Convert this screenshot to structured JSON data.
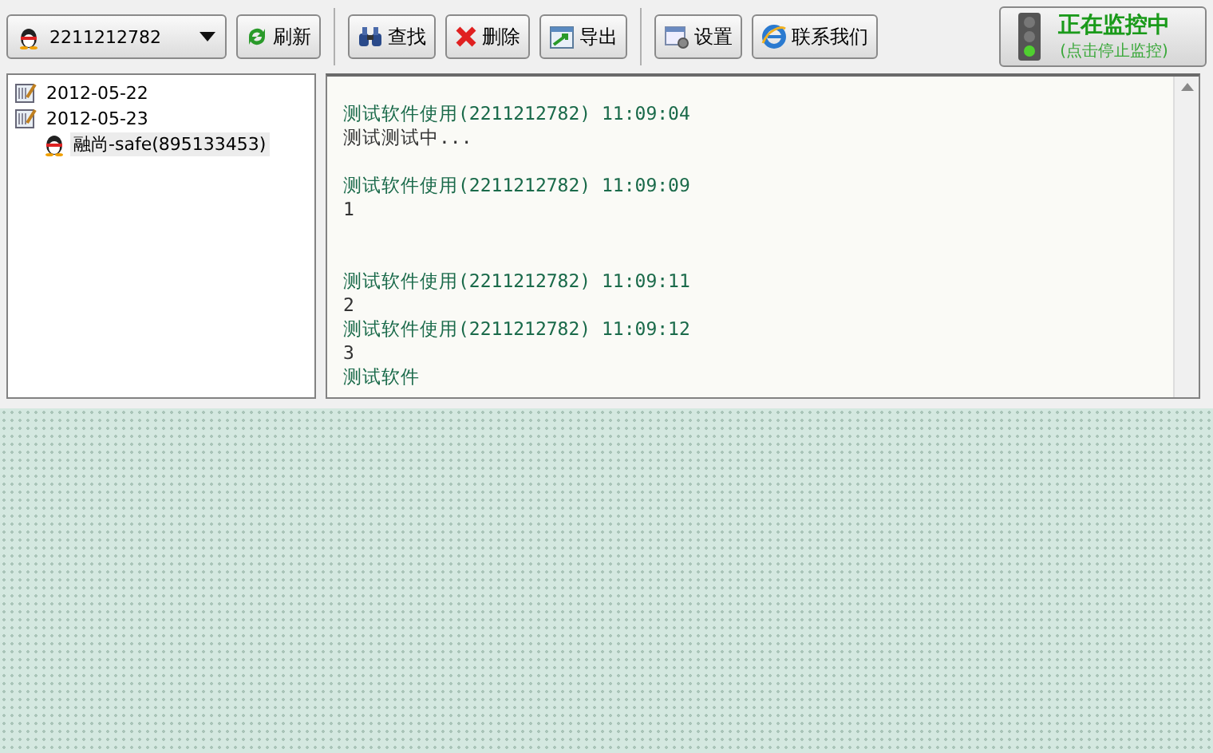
{
  "toolbar": {
    "account": {
      "value": "2211212782"
    },
    "buttons": [
      {
        "kind": "refresh",
        "label": "刷新"
      },
      {
        "kind": "find",
        "label": "查找"
      },
      {
        "kind": "delete",
        "label": "删除"
      },
      {
        "kind": "export",
        "label": "导出"
      },
      {
        "kind": "settings",
        "label": "设置"
      },
      {
        "kind": "contact",
        "label": "联系我们"
      }
    ],
    "monitor": {
      "title": "正在监控中",
      "subtitle": "(点击停止监控)",
      "on": true
    }
  },
  "tree": [
    {
      "kind": "date",
      "label": "2012-05-22"
    },
    {
      "kind": "date",
      "label": "2012-05-23",
      "children": [
        {
          "kind": "contact",
          "label": "融尚-safe(895133453)",
          "selected": true
        }
      ]
    }
  ],
  "log": [
    {
      "kind": "header",
      "text": "测试软件使用(2211212782) 11:09:04"
    },
    {
      "kind": "message",
      "text": "测试测试中..."
    },
    {
      "kind": "blank"
    },
    {
      "kind": "header",
      "text": "测试软件使用(2211212782) 11:09:09"
    },
    {
      "kind": "message",
      "text": "1"
    },
    {
      "kind": "blank"
    },
    {
      "kind": "blank"
    },
    {
      "kind": "header",
      "text": "测试软件使用(2211212782) 11:09:11"
    },
    {
      "kind": "message",
      "text": "2"
    },
    {
      "kind": "header",
      "text": "测试软件使用(2211212782) 11:09:12"
    },
    {
      "kind": "message",
      "text": "3"
    },
    {
      "kind": "header",
      "text": "测试软件"
    }
  ]
}
